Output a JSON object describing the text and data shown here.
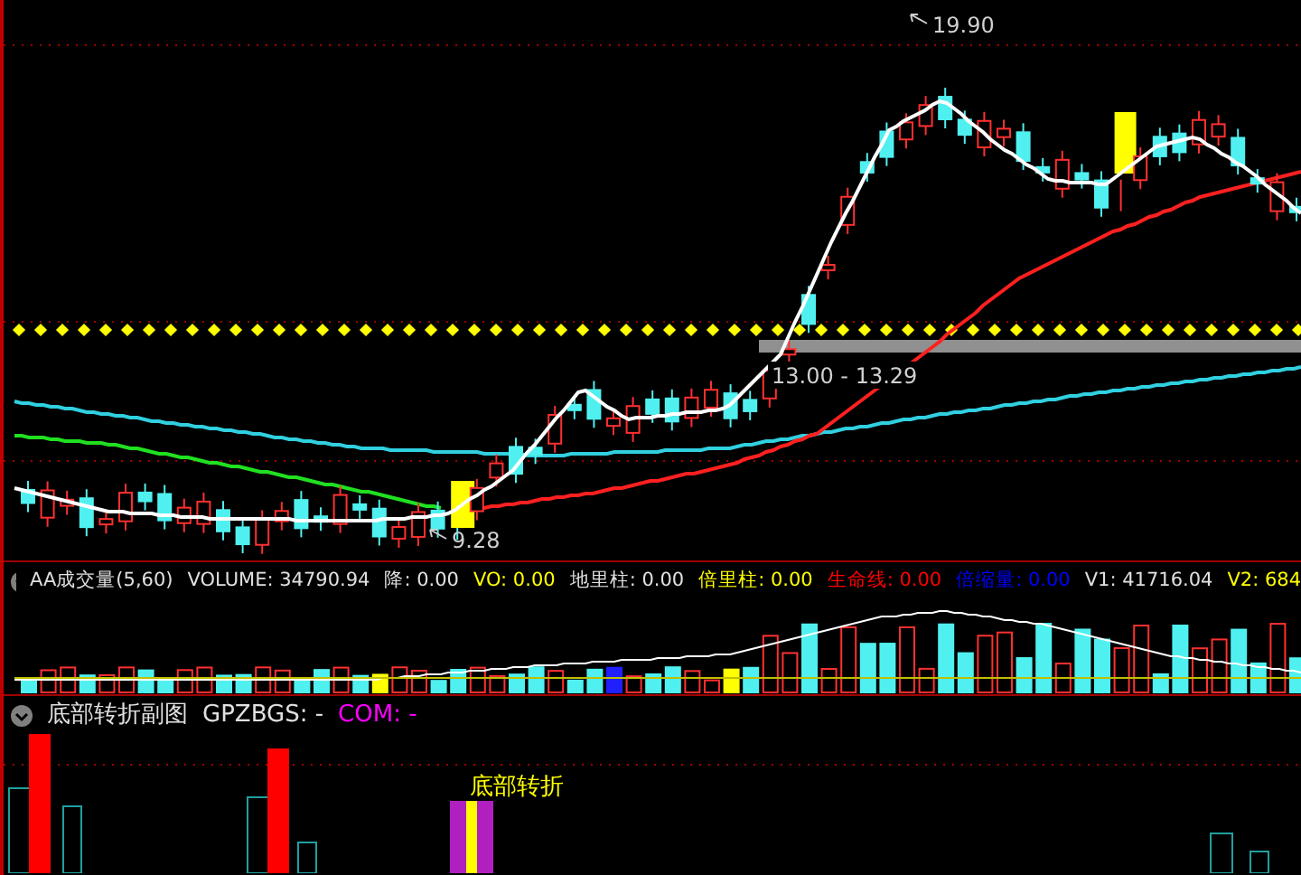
{
  "price_panel": {
    "high_label": "19.90",
    "range_label": "13.00 - 13.29",
    "low_label": "9.28"
  },
  "volume_panel": {
    "title": "AA成交量(5,60)",
    "indicators": [
      {
        "text": "VOLUME: 34790.94",
        "color": "#e0e0e0"
      },
      {
        "text": "降: 0.00",
        "color": "#e0e0e0"
      },
      {
        "text": "VO: 0.00",
        "color": "#ffff00"
      },
      {
        "text": "地里柱: 0.00",
        "color": "#e0e0e0"
      },
      {
        "text": "倍里柱: 0.00",
        "color": "#ffff00"
      },
      {
        "text": "生命线: 0.00",
        "color": "#ff0000"
      },
      {
        "text": "倍缩量: 0.00",
        "color": "#0000ff"
      },
      {
        "text": "V1: 41716.04",
        "color": "#e0e0e0"
      },
      {
        "text": "V2: 684",
        "color": "#ffff00"
      }
    ]
  },
  "bottom_panel": {
    "title": "底部转折副图",
    "indicators": [
      {
        "text": "GPZBGS: -",
        "color": "#e0e0e0"
      },
      {
        "text": "COM: -",
        "color": "#ff00ff"
      }
    ],
    "signal_label": "底部转折"
  }
}
